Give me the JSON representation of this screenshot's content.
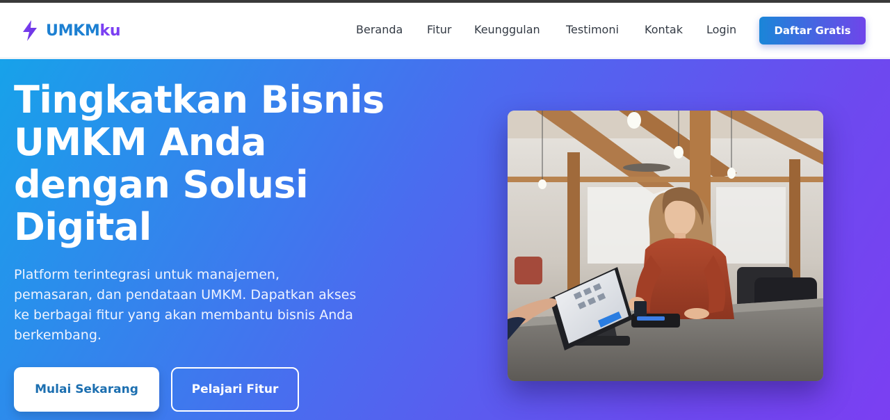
{
  "brand": {
    "name_part1": "UMKM",
    "name_part2": "ku",
    "icon": "lightning-bolt-icon",
    "color_primary": "#1d80d2",
    "color_accent": "#7b3ff2"
  },
  "nav": {
    "links": [
      {
        "label": "Beranda"
      },
      {
        "label": "Fitur"
      },
      {
        "label": "Keunggulan"
      },
      {
        "label": "Testimoni"
      },
      {
        "label": "Kontak"
      },
      {
        "label": "Login"
      }
    ],
    "cta_label": "Daftar Gratis"
  },
  "hero": {
    "title_lines": [
      "Tingkatkan Bisnis",
      "UMKM Anda",
      "dengan Solusi",
      "Digital"
    ],
    "description": "Platform terintegrasi untuk manajemen, pemasaran, dan pendataan UMKM. Dapatkan akses ke berbagai fitur yang akan membantu bisnis Anda berkembang.",
    "primary_button": "Mulai Sekarang",
    "secondary_button": "Pelajari Fitur",
    "gradient_start": "#17a2ea",
    "gradient_end": "#7b3ff2"
  }
}
